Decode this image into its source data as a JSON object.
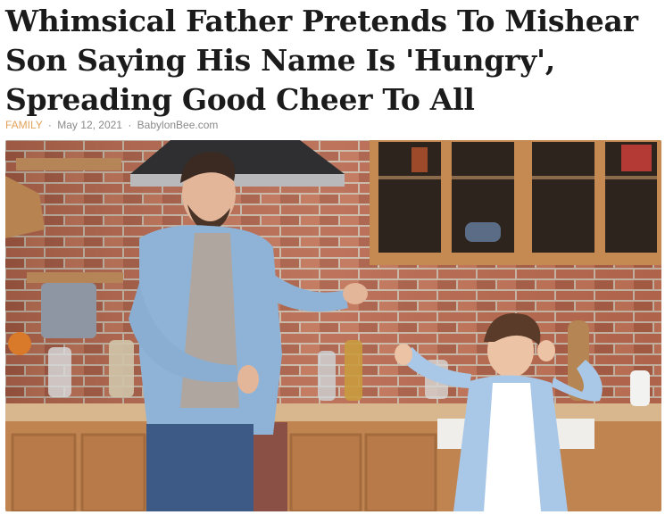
{
  "article": {
    "headline_lines": [
      "Whimsical Father Pretends To Mishear",
      "Son Saying His Name Is 'Hungry',",
      "Spreading Good Cheer To All"
    ],
    "category": "FAMILY",
    "date": "May 12, 2021",
    "source": "BabylonBee.com",
    "separator": "·"
  },
  "hero_image": {
    "icon": "photo-father-son-kitchen-icon",
    "colors": {
      "brick": "#b8684e",
      "cabinet": "#c48a52",
      "father_shirt": "#8fb3d6",
      "son_shirt": "#a9c7e6",
      "counter": "#d8b78e"
    }
  }
}
